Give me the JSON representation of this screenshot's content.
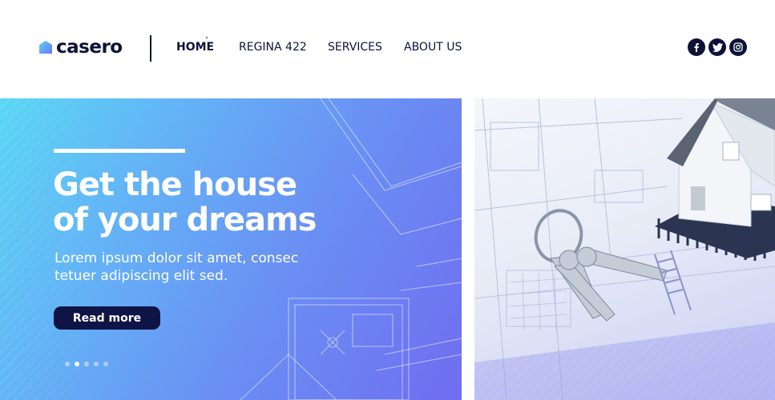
{
  "brand": {
    "name": "casero",
    "accent": "#5ad7f4",
    "dark": "#0d1238"
  },
  "nav": {
    "items": [
      {
        "label": "HOME",
        "active": true
      },
      {
        "label": "REGINA 422",
        "active": false
      },
      {
        "label": "SERVICES",
        "active": false
      },
      {
        "label": "ABOUT US",
        "active": false
      }
    ]
  },
  "social": {
    "icons": [
      "facebook-icon",
      "twitter-icon",
      "instagram-icon"
    ]
  },
  "hero": {
    "title": "Get the house\nof your dreams",
    "subtitle": "Lorem ipsum dolor sit amet, consec\ntetuer adipiscing elit sed.",
    "button_label": "Read more",
    "slide_count": 5,
    "active_slide": 2
  }
}
